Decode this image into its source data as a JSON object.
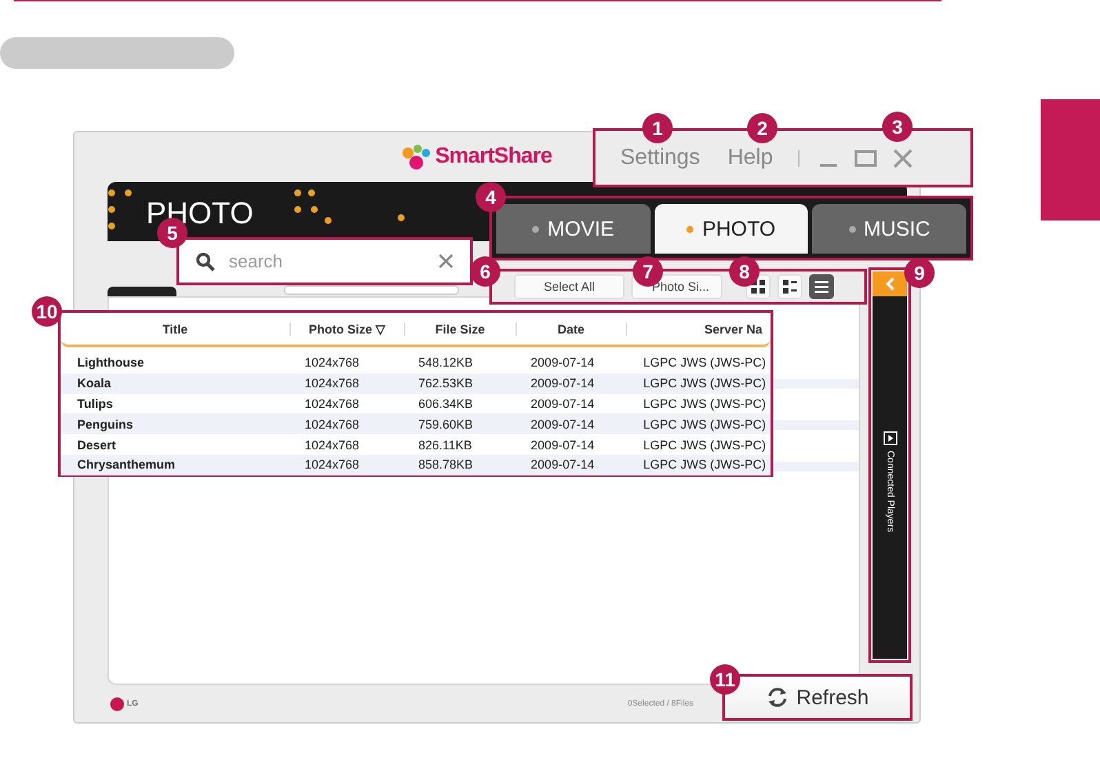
{
  "app": {
    "logo": "SmartShare",
    "banner": "PHOTO",
    "brand": "LG",
    "status": "0Selected / 8Files"
  },
  "menu": [
    {
      "label": "Settings"
    },
    {
      "label": "Help"
    }
  ],
  "tabs": [
    {
      "label": "MOVIE",
      "selected": false
    },
    {
      "label": "PHOTO",
      "selected": true
    },
    {
      "label": "MUSIC",
      "selected": false
    }
  ],
  "search": {
    "placeholder": "search"
  },
  "toolbar": {
    "select_all": "Select All",
    "sort": "Photo Si...",
    "views": [
      {
        "kind": "grid",
        "selected": false
      },
      {
        "kind": "detail",
        "selected": false
      },
      {
        "kind": "list",
        "selected": true
      }
    ]
  },
  "sidebar": {
    "label": "Connected Players"
  },
  "table": {
    "columns": [
      "Title",
      "Photo Size ▽",
      "File Size",
      "Date",
      "Server Na"
    ],
    "rows": [
      [
        "Lighthouse",
        "1024x768",
        "548.12KB",
        "2009-07-14",
        "LGPC JWS (JWS-PC)"
      ],
      [
        "Koala",
        "1024x768",
        "762.53KB",
        "2009-07-14",
        "LGPC JWS (JWS-PC)"
      ],
      [
        "Tulips",
        "1024x768",
        "606.34KB",
        "2009-07-14",
        "LGPC JWS (JWS-PC)"
      ],
      [
        "Penguins",
        "1024x768",
        "759.60KB",
        "2009-07-14",
        "LGPC JWS (JWS-PC)"
      ],
      [
        "Desert",
        "1024x768",
        "826.11KB",
        "2009-07-14",
        "LGPC JWS (JWS-PC)"
      ],
      [
        "Chrysanthemum",
        "1024x768",
        "858.78KB",
        "2009-07-14",
        "LGPC JWS (JWS-PC)"
      ]
    ]
  },
  "refresh": {
    "label": "Refresh"
  },
  "callouts": [
    "1",
    "2",
    "3",
    "4",
    "5",
    "6",
    "7",
    "8",
    "9",
    "10",
    "11"
  ]
}
